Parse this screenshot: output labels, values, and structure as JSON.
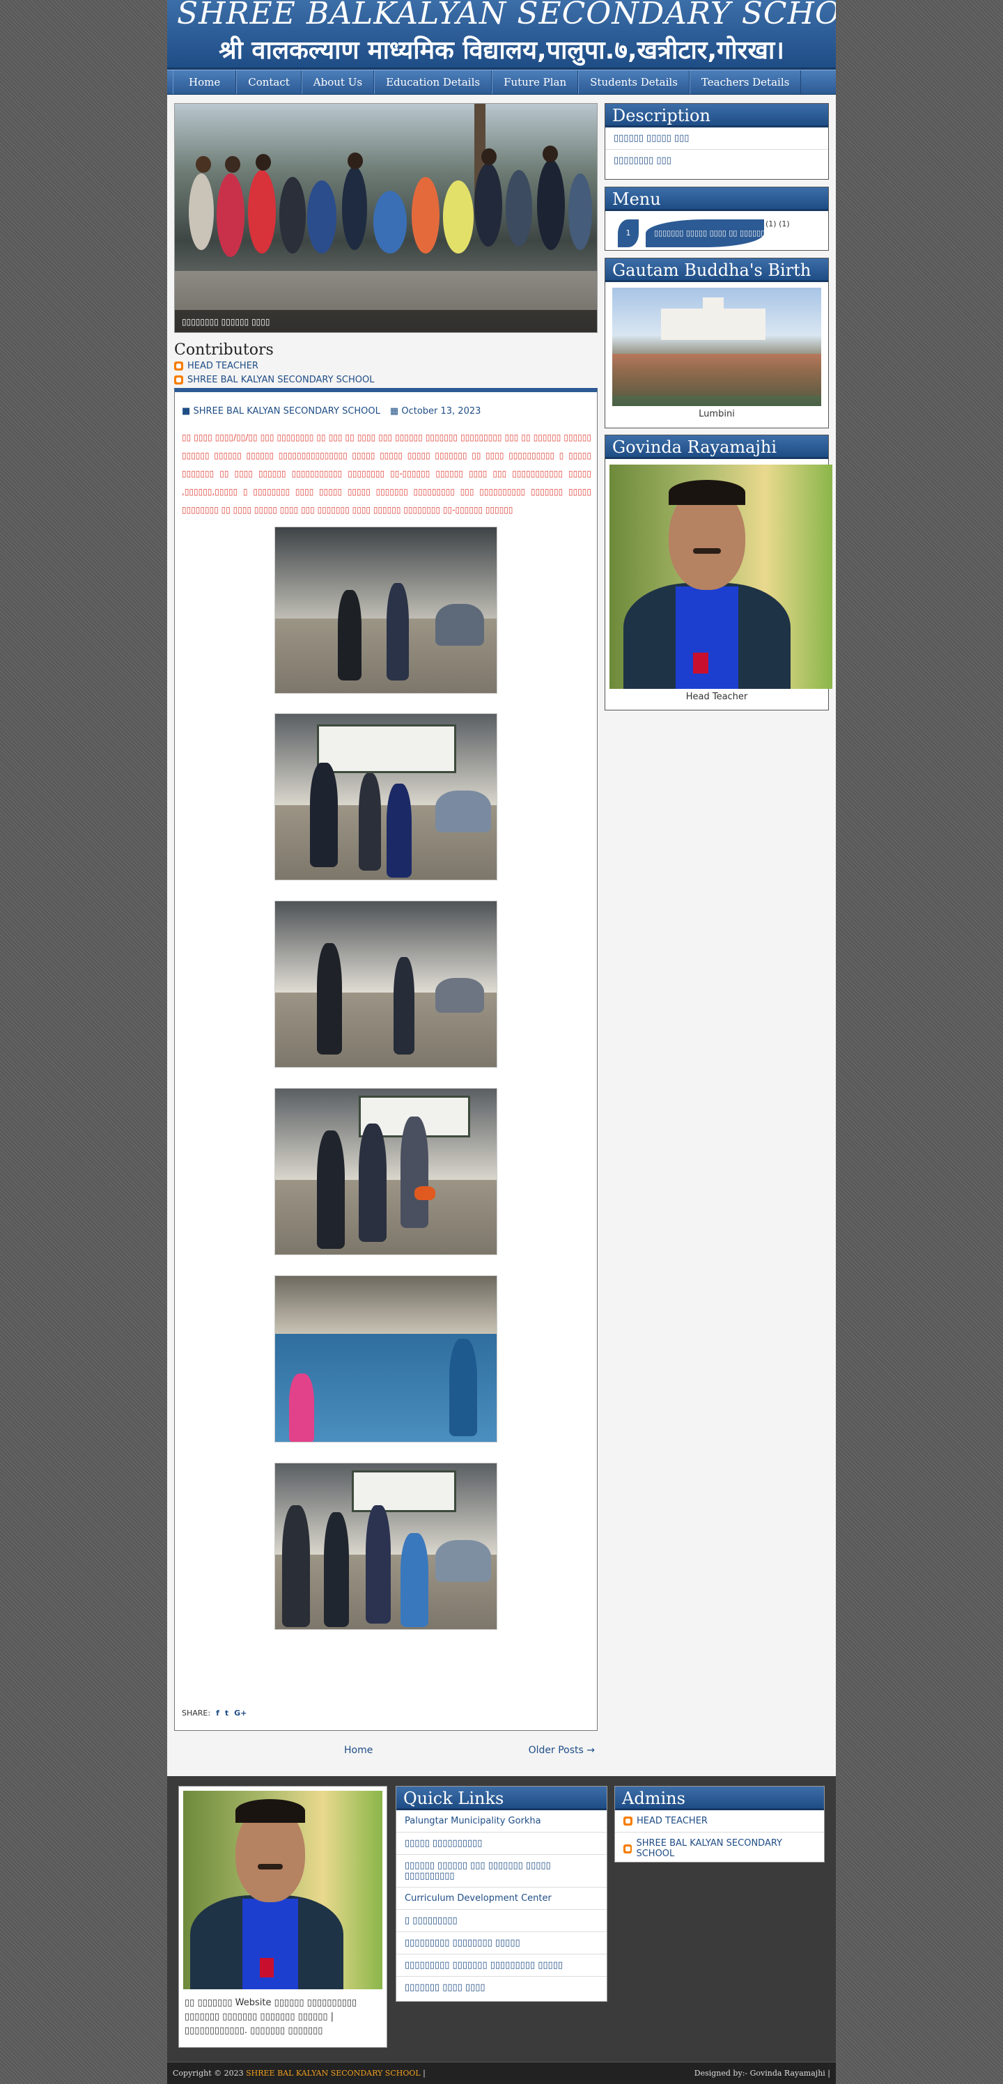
{
  "header": {
    "title_en": "SHREE BALKALYAN SECONDARY SCHOOL",
    "title_ne": "श्री वालकल्याण माध्यमिक विद्यालय,पालुपा.७,खत्रीटार,गोरखा।"
  },
  "nav": [
    "Home",
    "Contact",
    "About Us",
    "Education Details",
    "Future Plan",
    "Students Details",
    "Teachers Details"
  ],
  "slider": {
    "caption": "▯▯▯▯▯▯▯▯ ▯▯▯▯▯▯ ▯▯▯▯"
  },
  "contributors": {
    "title": "Contributors",
    "items": [
      "HEAD TEACHER",
      "SHREE BAL KALYAN SECONDARY SCHOOL"
    ]
  },
  "post": {
    "author": "SHREE BAL KALYAN SECONDARY SCHOOL",
    "date": "October 13, 2023",
    "body": "▯▯ ▯▯▯▯ ▯▯▯▯/▯▯/▯▯ ▯▯▯ ▯▯▯▯▯▯▯▯ ▯▯ ▯▯▯ ▯▯ ▯▯▯▯ ▯▯▯ ▯▯▯▯▯▯  ▯▯▯▯▯▯▯  ▯▯▯▯▯▯▯▯▯ ▯▯▯ ▯▯ ▯▯▯▯▯▯ ▯▯▯▯▯▯  ▯▯▯▯▯▯ ▯▯▯▯▯▯ ▯▯▯▯▯▯ ▯▯▯▯▯▯▯▯▯▯▯▯▯▯▯ ▯▯▯▯▯  ▯▯▯▯▯  ▯▯▯▯▯ ▯▯▯▯▯▯▯  ▯▯ ▯▯▯▯ ▯▯▯▯▯▯▯▯▯▯ ▯ ▯▯▯▯▯ ▯▯▯▯▯▯▯  ▯▯ ▯▯▯▯ ▯▯▯▯▯▯  ▯▯▯▯▯▯▯▯▯▯▯ ▯▯▯▯▯▯▯▯  ▯▯-▯▯▯▯▯▯  ▯▯▯▯▯▯ ▯▯▯▯ ▯▯▯ ▯▯▯▯▯▯▯▯▯▯▯  ▯▯▯▯▯ ,▯▯▯▯▯▯,▯▯▯▯▯ ▯ ▯▯▯▯▯▯▯▯ ▯▯▯▯ ▯▯▯▯▯ ▯▯▯▯▯  ▯▯▯▯▯▯▯  ▯▯▯▯▯▯▯▯▯ ▯▯▯ ▯▯▯▯▯▯▯▯▯▯ ▯▯▯▯▯▯▯  ▯▯▯▯▯ ▯▯▯▯▯▯▯▯ ▯▯ ▯▯▯▯ ▯▯▯▯▯ ▯▯▯▯ ▯▯▯ ▯▯▯▯▯▯▯ ▯▯▯▯ ▯▯▯▯▯▯ ▯▯▯▯▯▯▯▯  ▯▯-▯▯▯▯▯▯  ▯▯▯▯▯▯",
    "share_label": "SHARE:",
    "share_icons": [
      "f",
      "t",
      "G+"
    ]
  },
  "pager": {
    "home": "Home",
    "older": "Older Posts →"
  },
  "sidebar": {
    "description": {
      "title": "Description",
      "links": [
        "▯▯▯▯▯▯ ▯▯▯▯▯ ▯▯▯",
        "▯▯▯▯▯▯▯▯ ▯▯▯"
      ]
    },
    "menu": {
      "title": "Menu",
      "badge": "1",
      "item": "▯▯▯▯▯▯▯ ▯▯▯▯▯ ▯▯▯▯ ▯▯ ▯▯▯▯▯▯",
      "suffix": "(1) (1)"
    },
    "buddha": {
      "title": "Gautam Buddha's Birth Place",
      "caption": "Lumbini"
    },
    "govinda": {
      "title": "Govinda Rayamajhi",
      "caption": "Head Teacher"
    }
  },
  "lower": {
    "about_text": "▯▯ ▯▯▯▯▯▯▯ Website ▯▯▯▯▯▯ ▯▯▯▯▯▯▯▯▯▯ ▯▯▯▯▯▯▯ ▯▯▯▯▯▯▯ ▯▯▯▯▯▯▯ ▯▯▯▯▯▯ | ▯▯▯▯▯▯▯▯▯▯▯▯. ▯▯▯▯▯▯▯ ▯▯▯▯▯▯▯",
    "quick_links": {
      "title": "Quick Links",
      "items": [
        "Palungtar Municipality Gorkha",
        "▯▯▯▯▯ ▯▯▯▯▯▯▯▯▯▯",
        "▯▯▯▯▯▯ ▯▯▯▯▯▯ ▯▯▯ ▯▯▯▯▯▯▯ ▯▯▯▯▯ ▯▯▯▯▯▯▯▯▯▯",
        "Curriculum Development Center",
        "▯ ▯▯▯▯▯▯▯▯▯",
        "▯▯▯▯▯▯▯▯▯ ▯▯▯▯▯▯▯▯ ▯▯▯▯▯",
        "▯▯▯▯▯▯▯▯▯ ▯▯▯▯▯▯▯ ▯▯▯▯▯▯▯▯▯ ▯▯▯▯▯",
        "▯▯▯▯▯▯▯ ▯▯▯▯ ▯▯▯▯"
      ]
    },
    "admins": {
      "title": "Admins",
      "items": [
        "HEAD TEACHER",
        "SHREE BAL KALYAN SECONDARY SCHOOL"
      ]
    }
  },
  "footer": {
    "copyright": "Copyright © 2023",
    "owner": "SHREE BAL KALYAN SECONDARY SCHOOL",
    "sep": "|",
    "designed": "Designed by:- Govinda Rayamajhi |"
  }
}
